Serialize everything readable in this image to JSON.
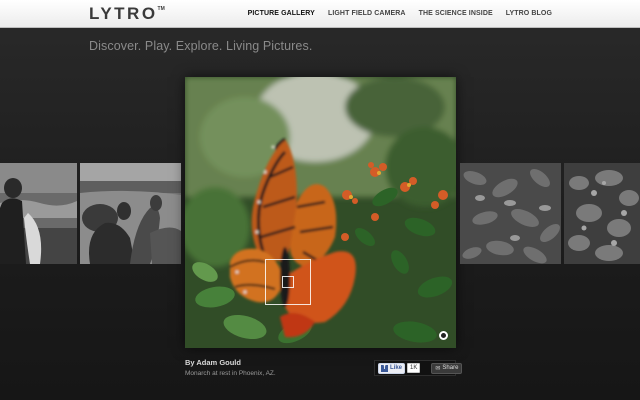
{
  "header": {
    "logo": "LYTRO",
    "logo_mark": "TM",
    "nav": [
      {
        "label": "PICTURE GALLERY",
        "active": true
      },
      {
        "label": "LIGHT FIELD CAMERA",
        "active": false
      },
      {
        "label": "THE SCIENCE INSIDE",
        "active": false
      },
      {
        "label": "LYTRO BLOG",
        "active": false
      }
    ]
  },
  "tagline": "Discover. Play. Explore. Living Pictures.",
  "gallery": {
    "featured": {
      "author": "By Adam Gould",
      "caption": "Monarch at rest in Phoenix, AZ."
    },
    "thumbnails": [
      "surfer",
      "sea-lions",
      "foliage",
      "shrubs"
    ]
  },
  "social": {
    "like_label": "Like",
    "like_count": "1K",
    "share_label": "Share",
    "fb_icon": "f"
  },
  "colors": {
    "background": "#1c1c1c",
    "topbar": "#f4f4f4",
    "fb_blue": "#3b5998"
  }
}
